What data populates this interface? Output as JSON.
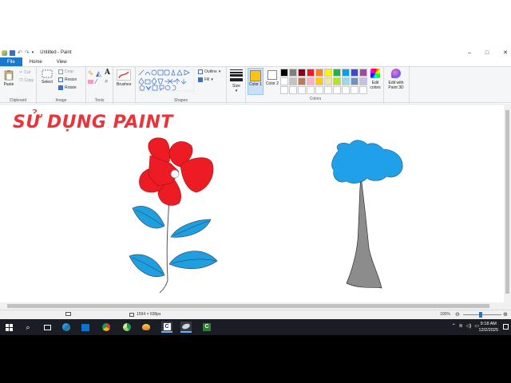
{
  "window": {
    "title": "Untitled - Paint",
    "controls": [
      "–",
      "□",
      "✕"
    ]
  },
  "tabs": [
    "File",
    "Home",
    "View"
  ],
  "ribbon": {
    "clipboard": {
      "label": "Clipboard",
      "paste": "Paste",
      "cut": "Cut",
      "copy": "Copy"
    },
    "image": {
      "label": "Image",
      "select": "Select",
      "crop": "Crop",
      "resize": "Resize",
      "rotate": "Rotate"
    },
    "tools": {
      "label": "Tools"
    },
    "brushes": {
      "label": "Brushes"
    },
    "shapes": {
      "label": "Shapes",
      "outline": "Outline",
      "fill": "Fill"
    },
    "size": {
      "label": "Size"
    },
    "color1": {
      "label": "Color 1",
      "value": "#ffc20e"
    },
    "color2": {
      "label": "Color 2",
      "value": "#ffffff"
    },
    "colors": {
      "label": "Colors",
      "palette": [
        "#000000",
        "#7f7f7f",
        "#880015",
        "#ed1c24",
        "#ff7f27",
        "#fff200",
        "#22b14c",
        "#00a2e8",
        "#3f48cc",
        "#a349a4",
        "#ffffff",
        "#c3c3c3",
        "#b97a57",
        "#ffaec9",
        "#ffc90e",
        "#efe4b0",
        "#b5e61d",
        "#99d9ea",
        "#7092be",
        "#c8bfe7",
        "#ffffff",
        "#ffffff",
        "#ffffff",
        "#ffffff",
        "#ffffff",
        "#ffffff",
        "#ffffff",
        "#ffffff",
        "#ffffff",
        "#ffffff"
      ]
    },
    "edit_colors": {
      "line1": "Edit",
      "line2": "colors"
    },
    "paint3d": {
      "line1": "Edit with",
      "line2": "Paint 3D"
    }
  },
  "canvas": {
    "heading": "SỬ DỤNG PAINT",
    "drawing": {
      "flower_petals_color": "#ed1c24",
      "leaf_color": "#1f9fe0",
      "tree_top_color": "#1fa0e8",
      "trunk_color": "#8c8c8c"
    }
  },
  "status": {
    "dimensions": "1594 × 638px",
    "zoom": "100%"
  },
  "taskbar": {
    "time": "9:18 AM",
    "date": "12/2/2025",
    "apps": [
      "start-icon",
      "search-icon",
      "task-view-icon",
      "edge-icon",
      "store-icon",
      "chrome-icon",
      "chrome-alt-icon",
      "paint-app-icon",
      "camtasia-icon",
      "network-app-icon",
      "terminal-icon"
    ]
  }
}
